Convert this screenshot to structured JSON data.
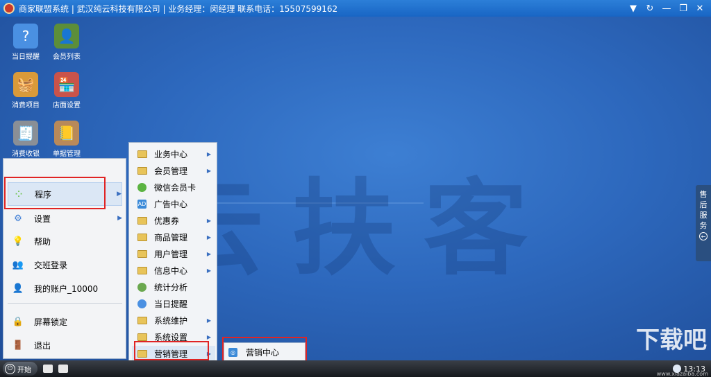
{
  "titlebar": {
    "title": "商家联盟系统 | 武汉纯云科技有限公司 | 业务经理：闵经理 联系电话：15507599162",
    "controls": [
      {
        "name": "dropdown-icon",
        "glyph": "▼"
      },
      {
        "name": "refresh-icon",
        "glyph": "↻"
      },
      {
        "name": "minimize-icon",
        "glyph": "—"
      },
      {
        "name": "restore-icon",
        "glyph": "❐"
      },
      {
        "name": "close-icon",
        "glyph": "✕"
      }
    ]
  },
  "desktop": {
    "watermark": "云扶客",
    "icons": [
      {
        "label": "当日提醒",
        "icon": "reminder-icon",
        "glyph": "?"
      },
      {
        "label": "会员列表",
        "icon": "members-icon",
        "glyph": "👤"
      },
      {
        "label": "消费项目",
        "icon": "basket-icon",
        "glyph": "🧺"
      },
      {
        "label": "店面设置",
        "icon": "store-icon",
        "glyph": "🏪"
      },
      {
        "label": "消费收银",
        "icon": "cash-register-icon",
        "glyph": "🧾"
      },
      {
        "label": "单据管理",
        "icon": "notebook-icon",
        "glyph": "📒"
      }
    ],
    "side_tab": {
      "label": [
        "售",
        "后",
        "服",
        "务"
      ],
      "arrow": "←"
    }
  },
  "start_menu": {
    "items": [
      {
        "label": "程序",
        "icon": "programs-icon",
        "glyph": "⁘",
        "has_arrow": true
      },
      {
        "label": "设置",
        "icon": "settings-gear-icon",
        "glyph": "⚙",
        "has_arrow": true
      },
      {
        "label": "帮助",
        "icon": "help-bulb-icon",
        "glyph": "💡",
        "has_arrow": false
      },
      {
        "label": "交班登录",
        "icon": "shift-users-icon",
        "glyph": "👥",
        "has_arrow": false
      },
      {
        "label": "我的账户_10000",
        "icon": "account-user-icon",
        "glyph": "👤",
        "has_arrow": false
      },
      {
        "label": "屏幕锁定",
        "icon": "lock-icon",
        "glyph": "🔒",
        "has_arrow": false
      },
      {
        "label": "退出",
        "icon": "exit-door-icon",
        "glyph": "🚪",
        "has_arrow": false
      }
    ]
  },
  "programs_submenu": {
    "items": [
      {
        "label": "业务中心",
        "type": "folder",
        "has_arrow": true
      },
      {
        "label": "会员管理",
        "type": "folder",
        "has_arrow": true
      },
      {
        "label": "微信会员卡",
        "type": "wechat",
        "has_arrow": false
      },
      {
        "label": "广告中心",
        "type": "ad",
        "has_arrow": false
      },
      {
        "label": "优惠券",
        "type": "folder",
        "has_arrow": true
      },
      {
        "label": "商品管理",
        "type": "folder",
        "has_arrow": true
      },
      {
        "label": "用户管理",
        "type": "folder",
        "has_arrow": true
      },
      {
        "label": "信息中心",
        "type": "folder",
        "has_arrow": true
      },
      {
        "label": "统计分析",
        "type": "stats",
        "has_arrow": false
      },
      {
        "label": "当日提醒",
        "type": "reminder",
        "has_arrow": false
      },
      {
        "label": "系统维护",
        "type": "folder",
        "has_arrow": true
      },
      {
        "label": "系统设置",
        "type": "folder",
        "has_arrow": true
      },
      {
        "label": "营销管理",
        "type": "folder",
        "has_arrow": true
      }
    ]
  },
  "marketing_submenu": {
    "items": [
      {
        "label": "营销中心"
      }
    ]
  },
  "taskbar": {
    "start_label": "开始",
    "time": "13:13"
  },
  "branding": {
    "watermark": "下载吧",
    "site": "www.xiazaiba.com"
  },
  "colors": {
    "highlight_box": "#e02424",
    "desktop_blue": "#2d68bd"
  }
}
